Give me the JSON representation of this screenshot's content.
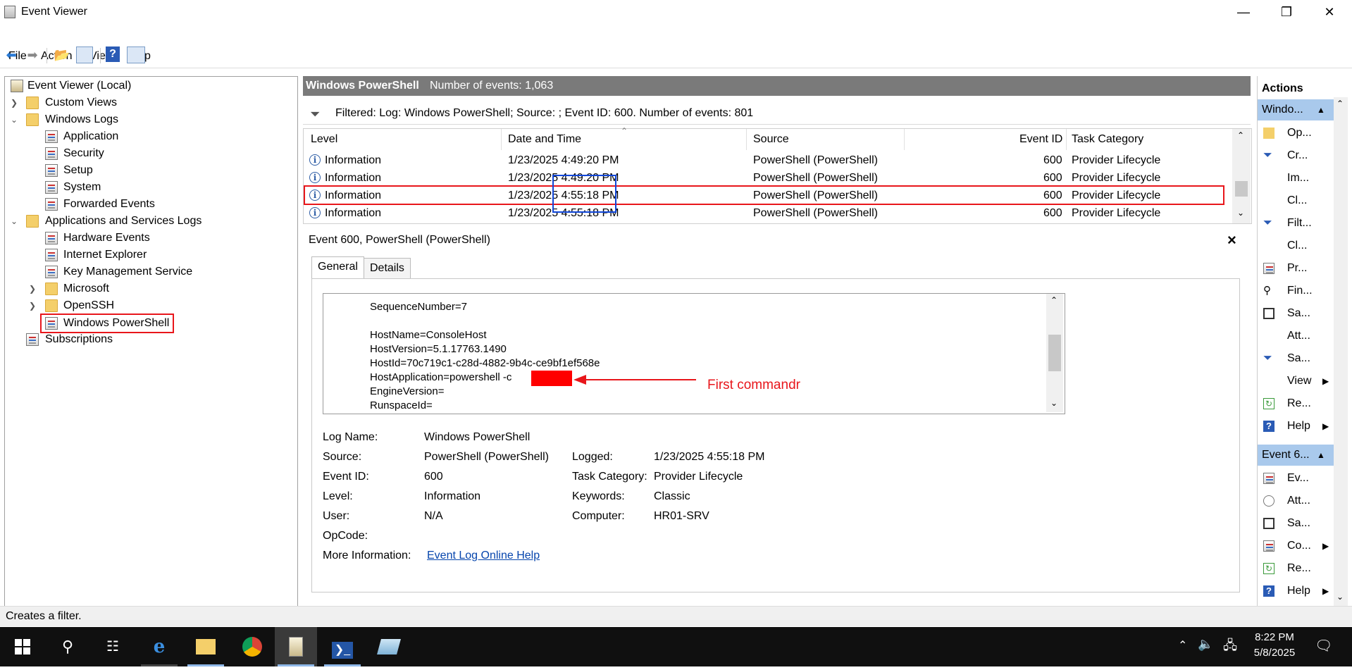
{
  "window": {
    "title": "Event Viewer",
    "minimize": "—",
    "restore": "❐",
    "close": "✕"
  },
  "menu": [
    "File",
    "Action",
    "View",
    "Help"
  ],
  "tree": {
    "root": "Event Viewer (Local)",
    "custom_views": "Custom Views",
    "windows_logs": "Windows Logs",
    "application": "Application",
    "security": "Security",
    "setup": "Setup",
    "system": "System",
    "forwarded_events": "Forwarded Events",
    "app_services_logs": "Applications and Services Logs",
    "hardware_events": "Hardware Events",
    "internet_explorer": "Internet Explorer",
    "key_management": "Key Management Service",
    "microsoft": "Microsoft",
    "openssh": "OpenSSH",
    "windows_powershell": "Windows PowerShell",
    "subscriptions": "Subscriptions"
  },
  "center": {
    "log_name": "Windows PowerShell",
    "event_count": "Number of events: 1,063",
    "filter_text": "Filtered: Log: Windows PowerShell; Source: ; Event ID: 600. Number of events: 801"
  },
  "table": {
    "headers": {
      "level": "Level",
      "datetime": "Date and Time",
      "source": "Source",
      "event_id": "Event ID",
      "task_category": "Task Category"
    },
    "rows": [
      {
        "level": "Information",
        "datetime": "1/23/2025 4:49:20 PM",
        "source": "PowerShell (PowerShell)",
        "event_id": "600",
        "task_category": "Provider Lifecycle"
      },
      {
        "level": "Information",
        "datetime": "1/23/2025 4:49:20 PM",
        "source": "PowerShell (PowerShell)",
        "event_id": "600",
        "task_category": "Provider Lifecycle"
      },
      {
        "level": "Information",
        "datetime": "1/23/2025 4:55:18 PM",
        "source": "PowerShell (PowerShell)",
        "event_id": "600",
        "task_category": "Provider Lifecycle"
      },
      {
        "level": "Information",
        "datetime": "1/23/2025 4:55:18 PM",
        "source": "PowerShell (PowerShell)",
        "event_id": "600",
        "task_category": "Provider Lifecycle"
      }
    ]
  },
  "detail": {
    "header": "Event 600, PowerShell (PowerShell)",
    "tabs": {
      "general": "General",
      "details": "Details"
    },
    "message_lines": [
      "SequenceNumber=7",
      "",
      "HostName=ConsoleHost",
      "HostVersion=5.1.17763.1490",
      "HostId=70c719c1-c28d-4882-9b4c-ce9bf1ef568e",
      "HostApplication=powershell -c",
      "EngineVersion=",
      "RunspaceId="
    ],
    "annotation": "First commandr",
    "fields": {
      "log_name_label": "Log Name:",
      "log_name": "Windows PowerShell",
      "source_label": "Source:",
      "source": "PowerShell (PowerShell)",
      "logged_label": "Logged:",
      "logged": "1/23/2025 4:55:18 PM",
      "event_id_label": "Event ID:",
      "event_id": "600",
      "task_category_label": "Task Category:",
      "task_category": "Provider Lifecycle",
      "level_label": "Level:",
      "level": "Information",
      "keywords_label": "Keywords:",
      "keywords": "Classic",
      "user_label": "User:",
      "user": "N/A",
      "computer_label": "Computer:",
      "computer": "HR01-SRV",
      "opcode_label": "OpCode:",
      "more_info_label": "More Information:",
      "more_info_link": "Event Log Online Help"
    }
  },
  "actions": {
    "title": "Actions",
    "section1": "Windo...",
    "items1": [
      "Op...",
      "Cr...",
      "Im...",
      "Cl...",
      "Filt...",
      "Cl...",
      "Pr...",
      "Fin...",
      "Sa...",
      "Att...",
      "Sa...",
      "View",
      "Re...",
      "Help"
    ],
    "section2": "Event 6...",
    "items2": [
      "Ev...",
      "Att...",
      "Sa...",
      "Co...",
      "Re...",
      "Help"
    ]
  },
  "status": "Creates a filter.",
  "taskbar": {
    "time": "8:22 PM",
    "date": "5/8/2025"
  }
}
